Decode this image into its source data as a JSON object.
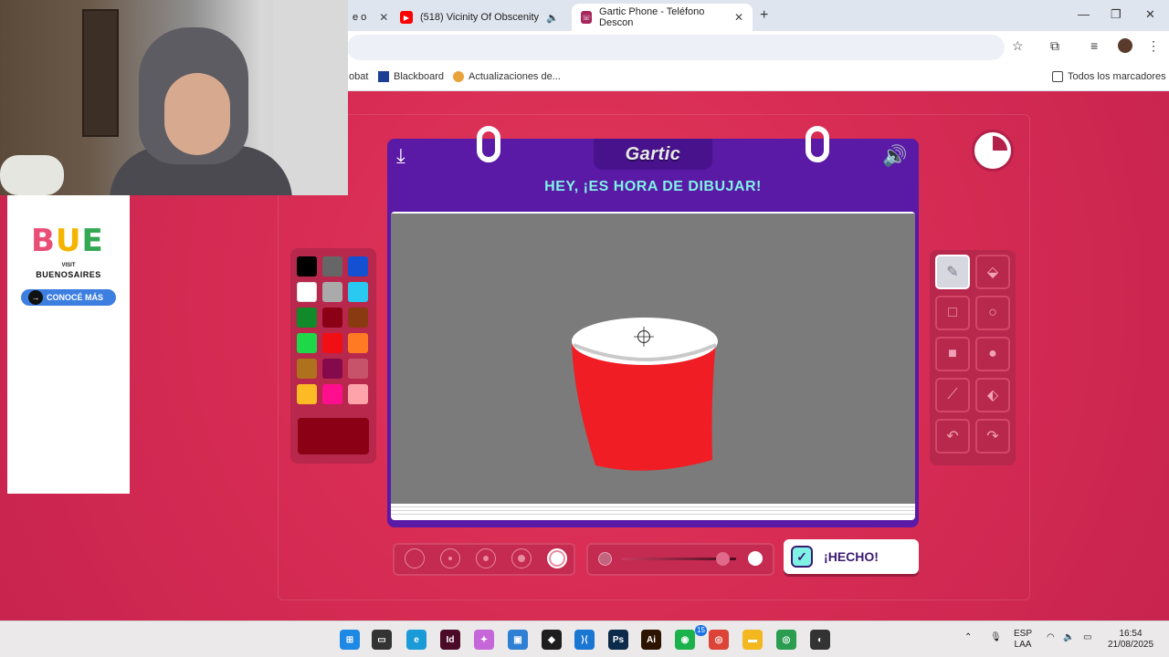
{
  "browser": {
    "tabs": [
      {
        "title": "e o",
        "favicon": "tab-favicon",
        "active": false
      },
      {
        "title": "(518) Vicinity Of Obscenity",
        "favicon": "youtube-icon",
        "active": false
      },
      {
        "title": "Gartic Phone - Teléfono Descon",
        "favicon": "gartic-icon",
        "active": true
      }
    ],
    "new_tab": "+",
    "window_controls": {
      "minimize": "—",
      "maximize": "❐",
      "close": "✕"
    },
    "bookmarks": [
      {
        "label": "obat",
        "icon": "bookmark-icon"
      },
      {
        "label": "Blackboard",
        "icon": "blackboard-icon"
      },
      {
        "label": "Actualizaciones de...",
        "icon": "updates-icon"
      }
    ],
    "all_bookmarks": "Todos los marcadores"
  },
  "ad": {
    "logo": [
      "B",
      "U",
      "E"
    ],
    "visit": "VISIT",
    "city": "BUENOSAIRES",
    "cta": "CONOCÉ MÁS",
    "cta_arrow": "→"
  },
  "game": {
    "brand": "Gartic",
    "heading": "HEY, ¡ES HORA DE DIBUJAR!",
    "download_icon": "⤓",
    "sound_icon": "🔊",
    "palette": [
      "#000000",
      "#666666",
      "#1450d2",
      "#ffffff",
      "#aaaaaa",
      "#29c9f2",
      "#118a2a",
      "#8b0014",
      "#8a3a10",
      "#1ed84a",
      "#f20f14",
      "#ff7a22",
      "#b0711c",
      "#850a4c",
      "#c7536a",
      "#fcba25",
      "#ff0f8d",
      "#ffa3aa"
    ],
    "current_color": "#8b0014",
    "tools": [
      {
        "name": "pencil",
        "glyph": "✎",
        "active": true
      },
      {
        "name": "eraser",
        "glyph": "⬙",
        "active": false
      },
      {
        "name": "rectangle",
        "glyph": "□",
        "active": false
      },
      {
        "name": "ellipse",
        "glyph": "○",
        "active": false
      },
      {
        "name": "filled-rectangle",
        "glyph": "■",
        "active": false
      },
      {
        "name": "filled-ellipse",
        "glyph": "●",
        "active": false
      },
      {
        "name": "line",
        "glyph": "⟋",
        "active": false
      },
      {
        "name": "fill-bucket",
        "glyph": "⬖",
        "active": false
      },
      {
        "name": "undo",
        "glyph": "↶",
        "active": false
      },
      {
        "name": "redo",
        "glyph": "↷",
        "active": false
      }
    ],
    "brush_sizes": [
      1,
      2,
      3,
      4,
      5
    ],
    "selected_brush_size": 5,
    "opacity_level": 0.88,
    "done_label": "¡HECHO!",
    "done_check": "✓",
    "drawing": {
      "body_color": "#f01e24",
      "top_color": "#ffffff"
    }
  },
  "taskbar": {
    "apps": [
      {
        "name": "windows-start",
        "color": "#1e88e5",
        "label": "⊞"
      },
      {
        "name": "file-manager",
        "color": "#333333",
        "label": "▭"
      },
      {
        "name": "edge",
        "color": "#1a9bd7",
        "label": "e"
      },
      {
        "name": "indesign",
        "color": "#4a0a28",
        "label": "Id"
      },
      {
        "name": "copilot",
        "color": "#c567d8",
        "label": "✦"
      },
      {
        "name": "photos",
        "color": "#2f7fd4",
        "label": "▣"
      },
      {
        "name": "figma",
        "color": "#1e1e1e",
        "label": "◆"
      },
      {
        "name": "vscode",
        "color": "#1976d2",
        "label": "⟩⟨"
      },
      {
        "name": "photoshop",
        "color": "#0c2a4a",
        "label": "Ps"
      },
      {
        "name": "illustrator",
        "color": "#2d1400",
        "label": "Ai"
      },
      {
        "name": "whatsapp",
        "color": "#1bb24c",
        "label": "◉"
      },
      {
        "name": "chrome",
        "color": "#db4437",
        "label": "◎"
      },
      {
        "name": "folder",
        "color": "#f3b81f",
        "label": "▬"
      },
      {
        "name": "chrome-2",
        "color": "#2a9d50",
        "label": "◎"
      },
      {
        "name": "app-misc",
        "color": "#333333",
        "label": "◐"
      }
    ],
    "whatsapp_badge": "15",
    "language": "ESP",
    "region": "LAA",
    "time": "16:54",
    "date": "21/08/2025"
  }
}
